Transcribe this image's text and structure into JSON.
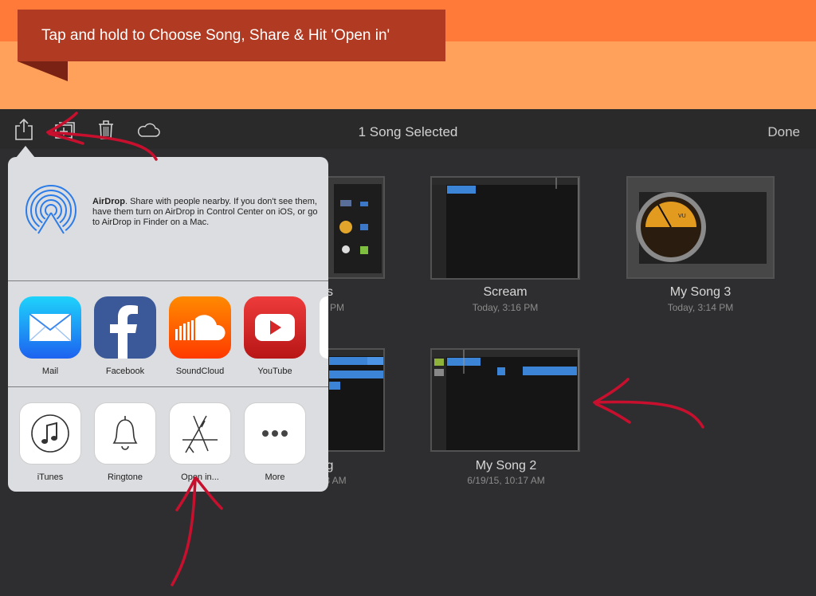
{
  "banner": {
    "caption": "Tap and hold to Choose Song, Share & Hit 'Open in'"
  },
  "toolbar": {
    "title": "1 Song Selected",
    "done_label": "Done",
    "icons": [
      "share-icon",
      "new-folder-icon",
      "trash-icon",
      "cloud-icon"
    ]
  },
  "songs": [
    {
      "name": "Scream",
      "date": "Today, 3:16 PM"
    },
    {
      "name": "My Song 3",
      "date": "Today, 3:14 PM"
    },
    {
      "name": "My Song 2",
      "date": "6/19/15, 10:17 AM"
    },
    {
      "name_fragment": "s",
      "date_fragment": "PM"
    },
    {
      "name_fragment": "g",
      "date_fragment": "3 AM"
    }
  ],
  "share_sheet": {
    "airdrop_bold": "AirDrop",
    "airdrop_text": ". Share with people nearby. If you don't see them, have them turn on AirDrop in Control Center on iOS, or go to AirDrop in Finder on a Mac.",
    "apps": [
      {
        "label": "Mail",
        "icon": "mail-icon",
        "color": "#1d8cf2"
      },
      {
        "label": "Facebook",
        "icon": "facebook-icon",
        "color": "#3b5998"
      },
      {
        "label": "SoundCloud",
        "icon": "soundcloud-icon",
        "color": "#ff5500"
      },
      {
        "label": "YouTube",
        "icon": "youtube-icon",
        "color": "#d62728"
      }
    ],
    "actions": [
      {
        "label": "iTunes",
        "icon": "itunes-icon"
      },
      {
        "label": "Ringtone",
        "icon": "bell-icon"
      },
      {
        "label": "Open in...",
        "icon": "app-store-icon"
      },
      {
        "label": "More",
        "icon": "more-icon"
      }
    ]
  },
  "colors": {
    "banner_dark": "#ff7a39",
    "banner_light": "#ffa15a",
    "caption_bg": "#b03a22",
    "annotation": "#c8102e"
  }
}
